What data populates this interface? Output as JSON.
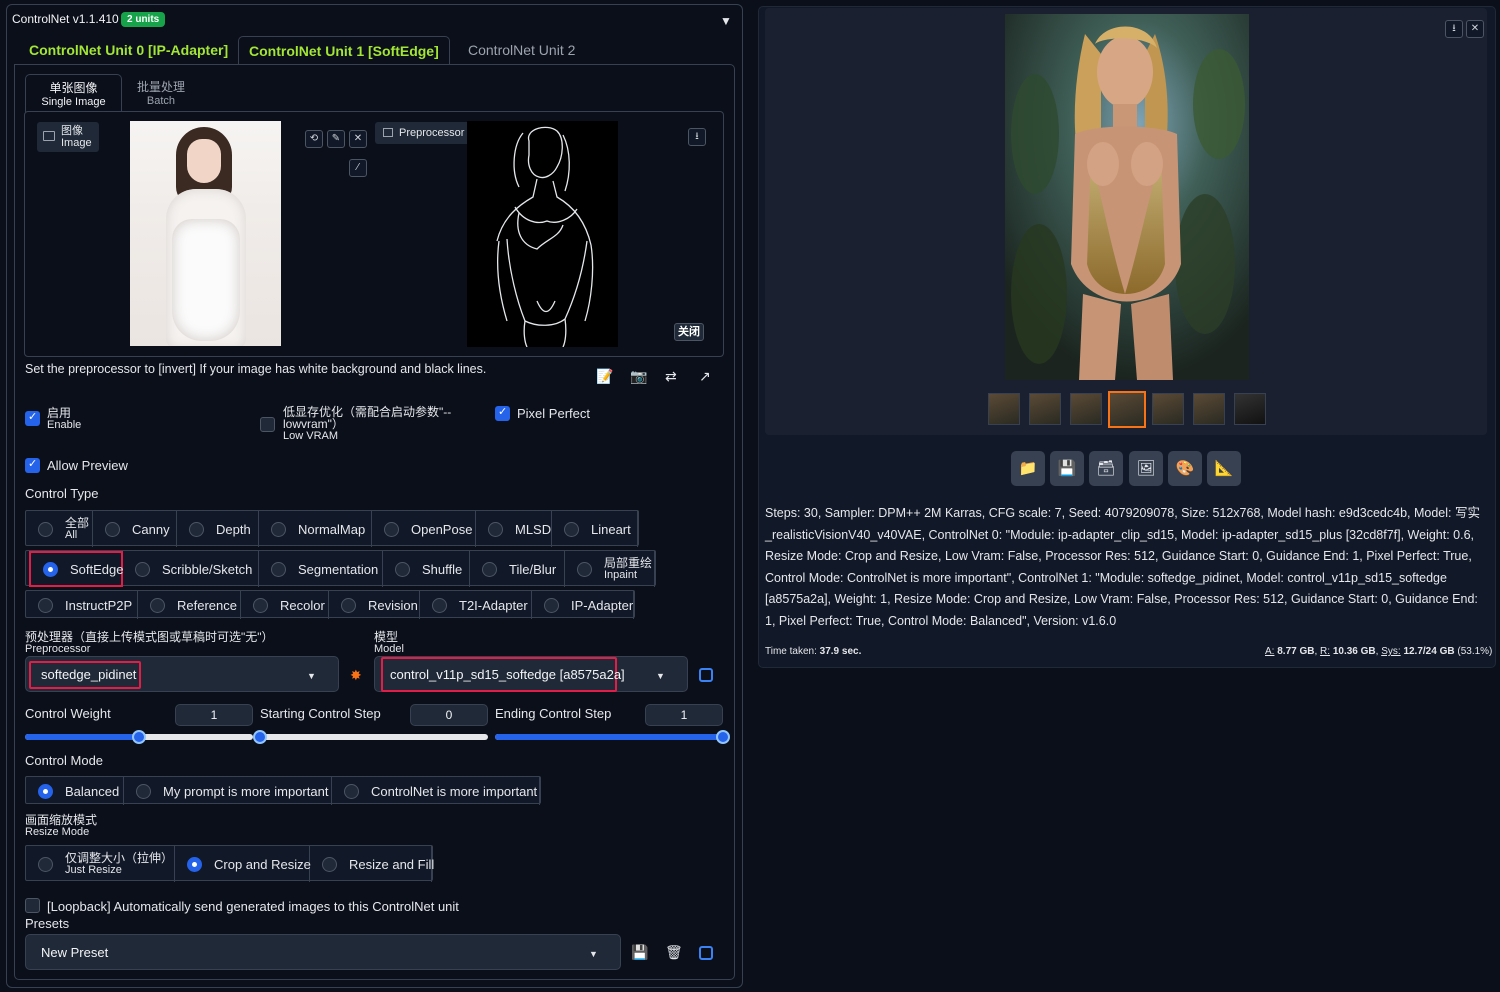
{
  "header": {
    "title": "ControlNet v1.1.410",
    "units_badge": "2 units",
    "collapse_icon": "▼"
  },
  "unit_tabs": [
    "ControlNet Unit 0 [IP-Adapter]",
    "ControlNet Unit 1 [SoftEdge]",
    "ControlNet Unit 2"
  ],
  "image_tabs": {
    "single": {
      "cn": "单张图像",
      "en": "Single Image"
    },
    "batch": {
      "cn": "批量处理",
      "en": "Batch"
    }
  },
  "image_label": {
    "cn": "图像",
    "en": "Image"
  },
  "preview_label": "Preprocessor Preview",
  "close_button": "关闭",
  "hint": "Set the preprocessor to [invert] If your image has white background and black lines.",
  "checkboxes": {
    "enable": {
      "cn": "启用",
      "en": "Enable",
      "checked": true
    },
    "lowvram": {
      "cn": "低显存优化（需配合启动参数\"--",
      "cn2": "lowvram\"）",
      "en": "Low VRAM",
      "checked": false
    },
    "pixel_perfect": {
      "label": "Pixel Perfect",
      "checked": true
    },
    "allow_preview": {
      "label": "Allow Preview",
      "checked": true
    }
  },
  "control_type": {
    "label": "Control Type",
    "all": {
      "cn": "全部",
      "en": "All"
    },
    "row1": [
      "Canny",
      "Depth",
      "NormalMap",
      "OpenPose",
      "MLSD",
      "Lineart"
    ],
    "row2": [
      "SoftEdge",
      "Scribble/Sketch",
      "Segmentation",
      "Shuffle",
      "Tile/Blur"
    ],
    "inpaint": {
      "cn": "局部重绘",
      "en": "Inpaint"
    },
    "row3": [
      "InstructP2P",
      "Reference",
      "Recolor",
      "Revision",
      "T2I-Adapter",
      "IP-Adapter"
    ],
    "selected": "SoftEdge"
  },
  "preprocessor": {
    "label_cn": "预处理器（直接上传模式图或草稿时可选\"无\"）",
    "label_en": "Preprocessor",
    "value": "softedge_pidinet"
  },
  "model": {
    "label_cn": "模型",
    "label_en": "Model",
    "value": "control_v11p_sd15_softedge [a8575a2a]"
  },
  "sliders": {
    "control_weight": {
      "label": "Control Weight",
      "value": "1",
      "fraction": 0.5
    },
    "starting_step": {
      "label": "Starting Control Step",
      "value": "0",
      "fraction": 0.0
    },
    "ending_step": {
      "label": "Ending Control Step",
      "value": "1",
      "fraction": 1.0
    }
  },
  "control_mode": {
    "label": "Control Mode",
    "options": [
      "Balanced",
      "My prompt is more important",
      "ControlNet is more important"
    ],
    "selected": "Balanced"
  },
  "resize_mode": {
    "label_cn": "画面缩放模式",
    "label_en": "Resize Mode",
    "just_resize": {
      "cn": "仅调整大小（拉伸）",
      "en": "Just Resize"
    },
    "options": [
      "Crop and Resize",
      "Resize and Fill"
    ],
    "selected": "Crop and Resize"
  },
  "loopback": "[Loopback] Automatically send generated images to this ControlNet unit",
  "presets": {
    "label": "Presets",
    "value": "New Preset"
  },
  "output": {
    "info": "Steps: 30, Sampler: DPM++ 2M Karras, CFG scale: 7, Seed: 4079209078, Size: 512x768, Model hash: e9d3cedc4b, Model: 写实_realisticVisionV40_v40VAE, ControlNet 0: \"Module: ip-adapter_clip_sd15, Model: ip-adapter_sd15_plus [32cd8f7f], Weight: 0.6, Resize Mode: Crop and Resize, Low Vram: False, Processor Res: 512, Guidance Start: 0, Guidance End: 1, Pixel Perfect: True, Control Mode: ControlNet is more important\", ControlNet 1: \"Module: softedge_pidinet, Model: control_v11p_sd15_softedge [a8575a2a], Weight: 1, Resize Mode: Crop and Resize, Low Vram: False, Processor Res: 512, Guidance Start: 0, Guidance End: 1, Pixel Perfect: True, Control Mode: Balanced\", Version: v1.6.0",
    "time_label": "Time taken:",
    "time_value": "37.9 sec.",
    "vram": {
      "a_label": "A:",
      "a": "8.77 GB",
      "r_label": "R:",
      "r": "10.36 GB",
      "sys_label": "Sys:",
      "sys": "12.7/24 GB",
      "pct": "(53.1%)"
    }
  },
  "colors": {
    "accent": "#2563eb",
    "green": "#a3e635",
    "highlight": "#e11d48",
    "thumb_selected": "#f97316"
  }
}
